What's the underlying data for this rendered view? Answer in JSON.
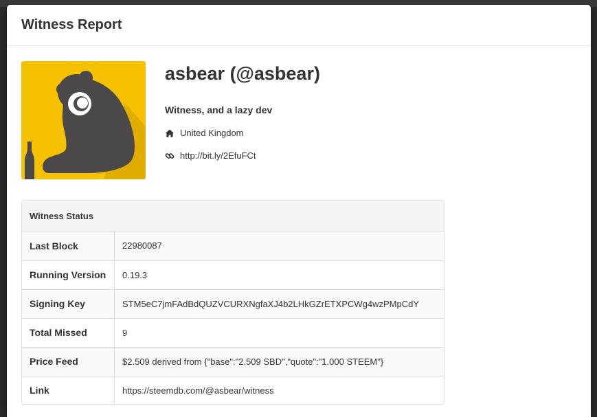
{
  "modal": {
    "title": "Witness Report"
  },
  "profile": {
    "name": "asbear (@asbear)",
    "about": "Witness, and a lazy dev",
    "location": "United Kingdom",
    "website": "http://bit.ly/2EfuFCt",
    "avatar_bg": "#f5c100",
    "avatar_fg": "#4a4848",
    "location_icon": "home-icon",
    "website_icon": "link-icon"
  },
  "status": {
    "heading": "Witness Status",
    "rows": [
      {
        "label": "Last Block",
        "value": "22980087"
      },
      {
        "label": "Running Version",
        "value": "0.19.3"
      },
      {
        "label": "Signing Key",
        "value": "STM5eC7jmFAdBdQUZVCURXNgfaXJ4b2LHkGZrETXPCWg4wzPMpCdY"
      },
      {
        "label": "Total Missed",
        "value": "9"
      },
      {
        "label": "Price Feed",
        "value": "$2.509 derived from {\"base\":\"2.509 SBD\",\"quote\":\"1.000 STEEM\"}"
      },
      {
        "label": "Link",
        "value": "https://steemdb.com/@asbear/witness"
      }
    ]
  }
}
